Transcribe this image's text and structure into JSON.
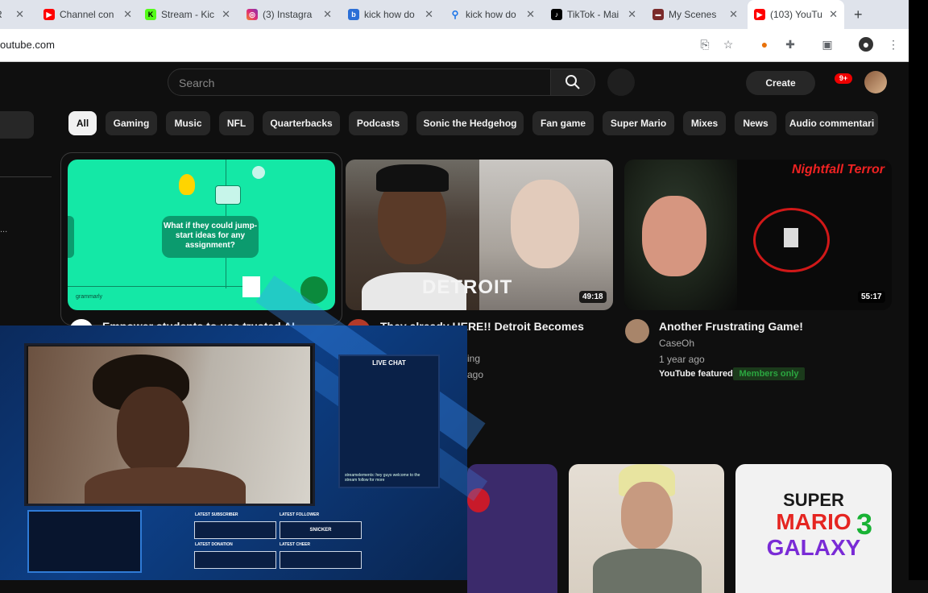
{
  "browser": {
    "tabs": [
      {
        "label": "Channel con",
        "icon": "youtube-icon"
      },
      {
        "label": "Stream - Kic",
        "icon": "kick-icon"
      },
      {
        "label": "(3) Instagra",
        "icon": "instagram-icon"
      },
      {
        "label": "kick how do",
        "icon": "search-engine-icon"
      },
      {
        "label": "kick how do",
        "icon": "search-icon"
      },
      {
        "label": "TikTok - Mai",
        "icon": "tiktok-icon"
      },
      {
        "label": "My Scenes",
        "icon": "streamlabs-icon"
      },
      {
        "label": "(103) YouTu",
        "icon": "youtube-icon",
        "active": true
      }
    ],
    "url": "outube.com"
  },
  "header": {
    "search_placeholder": "Search",
    "create_label": "Create",
    "notification_count": "9+"
  },
  "chips": [
    "All",
    "Gaming",
    "Music",
    "NFL",
    "Quarterbacks",
    "Podcasts",
    "Sonic the Hedgehog",
    "Fan game",
    "Super Mario",
    "Mixes",
    "News",
    "Audio commentari"
  ],
  "videos": [
    {
      "thumb_text": "What if they could jump-start ideas for any assignment?",
      "thumb_brand": "grammarly",
      "title": "Empower students to use trusted AI"
    },
    {
      "thumb_text": "DETROIT",
      "duration": "49:18",
      "title": "They already HERE!! Detroit Becomes",
      "meta1": "ing",
      "meta2": "ago"
    },
    {
      "thumb_text": "Nightfall Terror",
      "duration": "55:17",
      "title": "Another Frustrating Game!",
      "channel": "CaseOh",
      "age": "1 year ago",
      "badge1": "YouTube featured",
      "badge2": "Members only"
    }
  ],
  "row2": {
    "mario_text_1": "SUPER",
    "mario_text_2": "MARIO",
    "mario_text_3": "GALAXY",
    "mario_num": "3"
  },
  "overlay": {
    "chat_title": "LIVE CHAT",
    "chat_message": "streamelements: hey guys welcome to the stream follow for more",
    "latest_sub_label": "LATEST SUBSCRIBER",
    "latest_follower_label": "LATEST FOLLOWER",
    "latest_follower_value": "SNICKER",
    "latest_donation_label": "LATEST DONATION",
    "latest_cheer_label": "LATEST CHEER"
  }
}
